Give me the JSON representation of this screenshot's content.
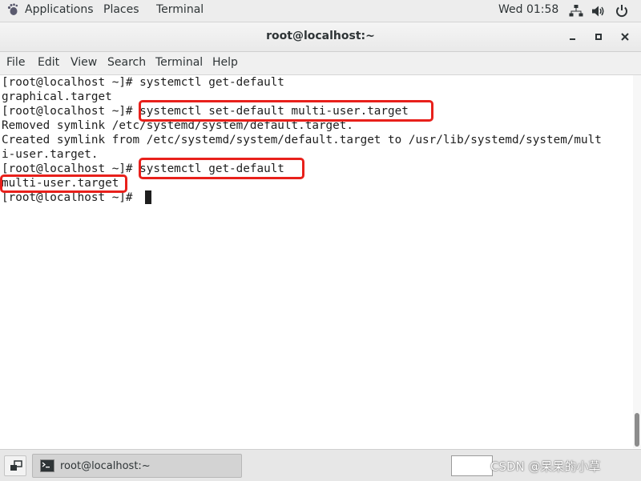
{
  "topbar": {
    "applications_label": "Applications",
    "places_label": "Places",
    "terminal_label": "Terminal",
    "clock": "Wed 01:58"
  },
  "window": {
    "title": "root@localhost:~"
  },
  "menubar": {
    "items": [
      "File",
      "Edit",
      "View",
      "Search",
      "Terminal",
      "Help"
    ]
  },
  "terminal": {
    "lines": [
      "[root@localhost ~]# systemctl get-default",
      "graphical.target",
      "[root@localhost ~]# systemctl set-default multi-user.target",
      "Removed symlink /etc/systemd/system/default.target.",
      "Created symlink from /etc/systemd/system/default.target to /usr/lib/systemd/system/mult",
      "i-user.target.",
      "[root@localhost ~]# systemctl get-default",
      "multi-user.target",
      "[root@localhost ~]# "
    ],
    "highlight_color": "#e8201b"
  },
  "taskbar": {
    "window_label": "root@localhost:~"
  },
  "watermark": "CSDN @呆呆的小草",
  "icons": {
    "applications": "gnome-foot-icon",
    "network": "network-icon",
    "volume": "volume-icon",
    "power": "power-icon",
    "terminal": "terminal-icon",
    "show_desktop": "show-desktop-icon"
  }
}
